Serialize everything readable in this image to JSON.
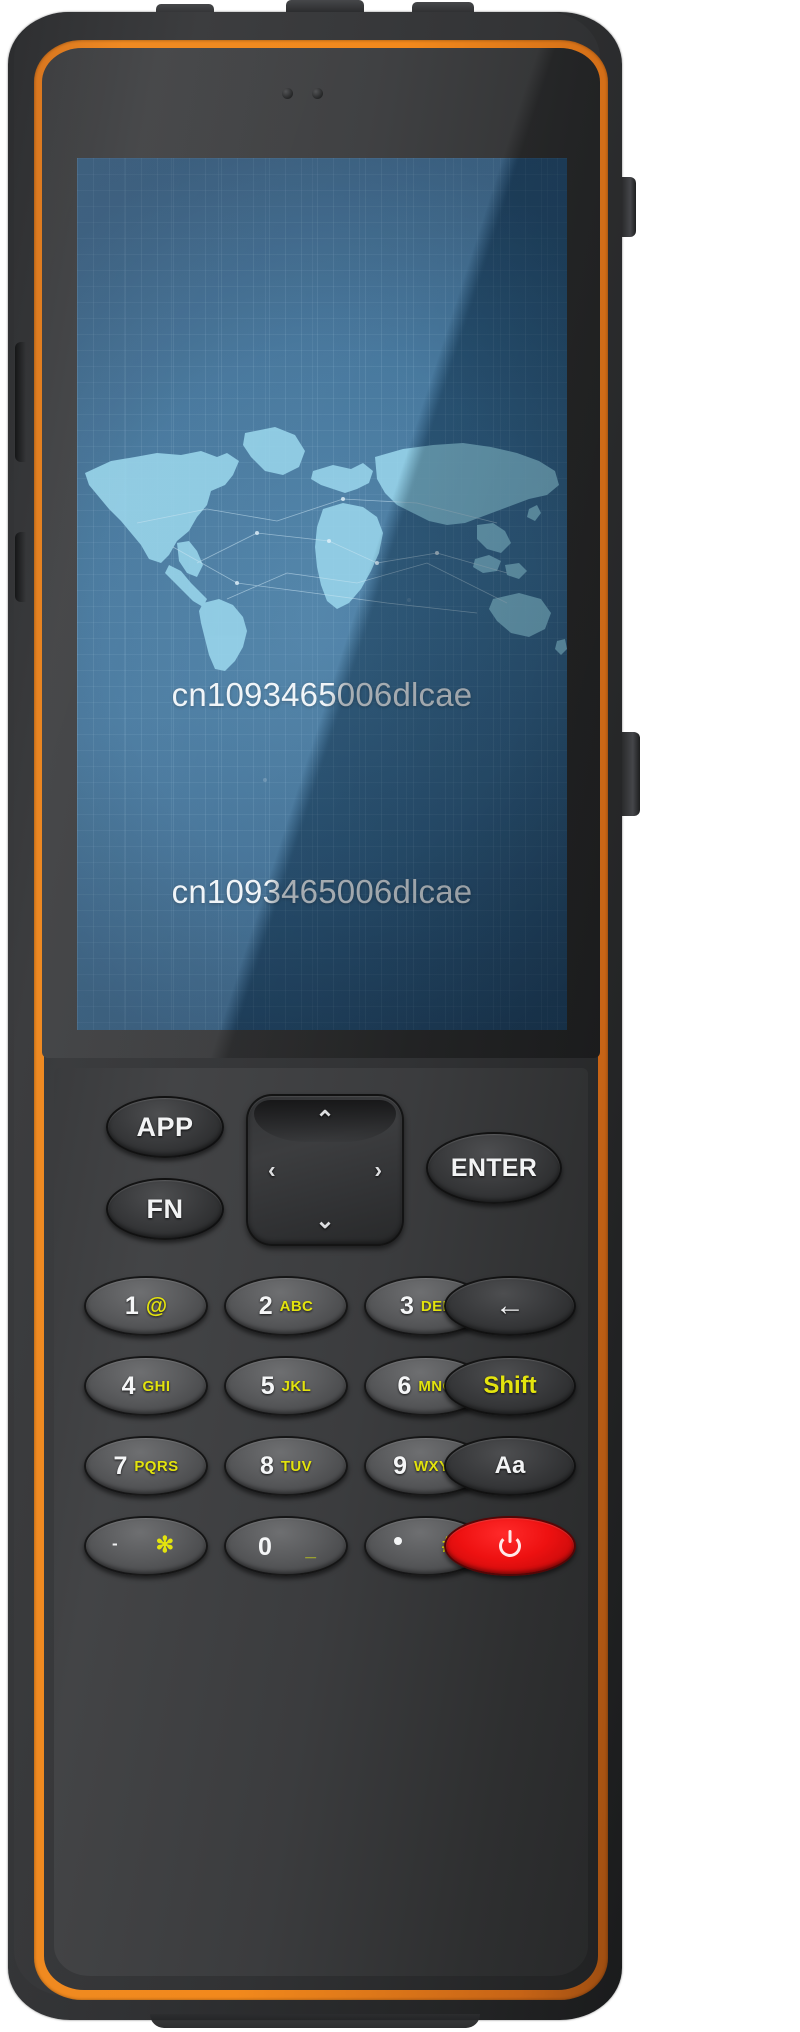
{
  "device": {
    "type": "rugged-handheld-pda",
    "body_color": "#313234",
    "trim_color": "#f2891c",
    "accent_yellow": "#e3e30d",
    "power_red": "#ee1111"
  },
  "screen": {
    "background_color": "#356b94",
    "wallpaper": "world-map-grid",
    "text_line_1": "cn1093465006dlcae",
    "text_line_2": "cn1093465006dlcae",
    "text_color": "#eef4f8"
  },
  "keypad": {
    "function_keys": {
      "app": "APP",
      "fn": "FN",
      "enter": "ENTER"
    },
    "dpad": {
      "up": "⌃",
      "down": "⌄",
      "left": "‹",
      "right": "›"
    },
    "rows": [
      [
        {
          "name": "key-1",
          "digit": "1",
          "letters": "@",
          "style": "light"
        },
        {
          "name": "key-2",
          "digit": "2",
          "letters": "ABC",
          "style": "light"
        },
        {
          "name": "key-3",
          "digit": "3",
          "letters": "DEF",
          "style": "light"
        },
        {
          "name": "key-backspace",
          "label": "←",
          "style": "dark"
        }
      ],
      [
        {
          "name": "key-4",
          "digit": "4",
          "letters": "GHI",
          "style": "light"
        },
        {
          "name": "key-5",
          "digit": "5",
          "letters": "JKL",
          "style": "light"
        },
        {
          "name": "key-6",
          "digit": "6",
          "letters": "MNO",
          "style": "light"
        },
        {
          "name": "key-shift",
          "label": "Shift",
          "style": "dark"
        }
      ],
      [
        {
          "name": "key-7",
          "digit": "7",
          "letters": "PQRS",
          "style": "light"
        },
        {
          "name": "key-8",
          "digit": "8",
          "letters": "TUV",
          "style": "light"
        },
        {
          "name": "key-9",
          "digit": "9",
          "letters": "WXYZ",
          "style": "light"
        },
        {
          "name": "key-case",
          "label": "Aa",
          "style": "dark"
        }
      ],
      [
        {
          "name": "key-star",
          "primary": "-",
          "secondary": "✻",
          "style": "light"
        },
        {
          "name": "key-0",
          "primary": "0",
          "secondary": "_",
          "style": "light"
        },
        {
          "name": "key-hash",
          "primary": ".",
          "secondary": "#",
          "style": "light"
        },
        {
          "name": "key-power",
          "label": "⏻",
          "style": "red"
        }
      ]
    ],
    "labels": {
      "k1_digit": "1",
      "k1_letters": "@",
      "k2_digit": "2",
      "k2_letters": "ABC",
      "k3_digit": "3",
      "k3_letters": "DEF",
      "k4_digit": "4",
      "k4_letters": "GHI",
      "k5_digit": "5",
      "k5_letters": "JKL",
      "k6_digit": "6",
      "k6_letters": "MNO",
      "k7_digit": "7",
      "k7_letters": "PQRS",
      "k8_digit": "8",
      "k8_letters": "TUV",
      "k9_digit": "9",
      "k9_letters": "WXYZ",
      "kstar_left": "-",
      "kstar_right": "✻",
      "k0_digit": "0",
      "k0_under": "_",
      "khash_right": "#",
      "backspace": "←",
      "shift": "Shift",
      "aa": "Aa"
    }
  }
}
